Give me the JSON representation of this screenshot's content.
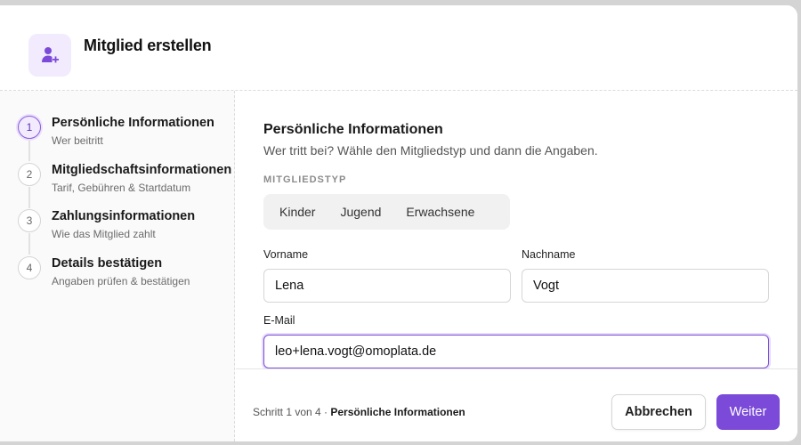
{
  "dialog": {
    "title": "Mitglied erstellen",
    "icon": "user-plus-icon",
    "accent": "#7b4ad8"
  },
  "steps": [
    {
      "number": "1",
      "title": "Persönliche Informationen",
      "subtitle": "Wer beitritt",
      "active": true
    },
    {
      "number": "2",
      "title": "Mitgliedschaftsinformationen",
      "subtitle": "Tarif, Gebühren & Startdatum",
      "active": false
    },
    {
      "number": "3",
      "title": "Zahlungsinformationen",
      "subtitle": "Wie das Mitglied zahlt",
      "active": false
    },
    {
      "number": "4",
      "title": "Details bestätigen",
      "subtitle": "Angaben prüfen & bestätigen",
      "active": false
    }
  ],
  "form": {
    "title": "Persönliche Informationen",
    "subtitle": "Wer tritt bei? Wähle den Mitgliedstyp und dann die Angaben.",
    "member_type_label": "MITGLIEDSTYP",
    "member_types": [
      "Kinder",
      "Jugend",
      "Erwachsene"
    ],
    "first_name_label": "Vorname",
    "first_name_value": "Lena",
    "last_name_label": "Nachname",
    "last_name_value": "Vogt",
    "email_label": "E-Mail",
    "email_value": "leo+lena.vogt@omoplata.de"
  },
  "footer": {
    "step_indicator": "Schritt 1 von 4 · ",
    "step_name": "Persönliche Informationen",
    "cancel_label": "Abbrechen",
    "next_label": "Weiter"
  }
}
